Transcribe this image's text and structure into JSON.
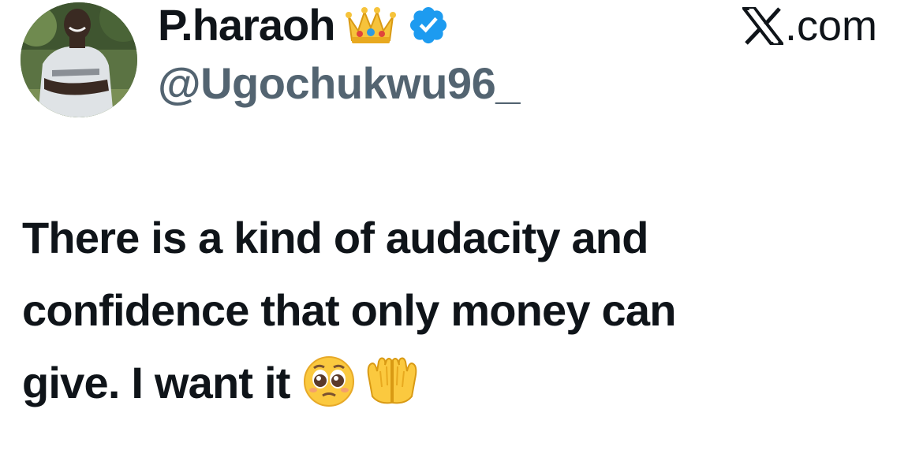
{
  "author": {
    "display_name": "P.haraoh",
    "handle": "@Ugochukwu96_",
    "badges": [
      "crown-emoji",
      "verified-badge"
    ],
    "verified_color": "#1d9bf0"
  },
  "source": {
    "label": ".com",
    "logo": "x-logo-icon"
  },
  "tweet": {
    "lines": [
      "There is a kind of audacity and",
      "confidence that only money can",
      "give. I want it"
    ],
    "trailing_emojis": [
      "pleading-face-emoji",
      "palms-up-together-emoji"
    ]
  },
  "colors": {
    "text": "#0f1419",
    "muted": "#536471",
    "background": "#ffffff"
  }
}
